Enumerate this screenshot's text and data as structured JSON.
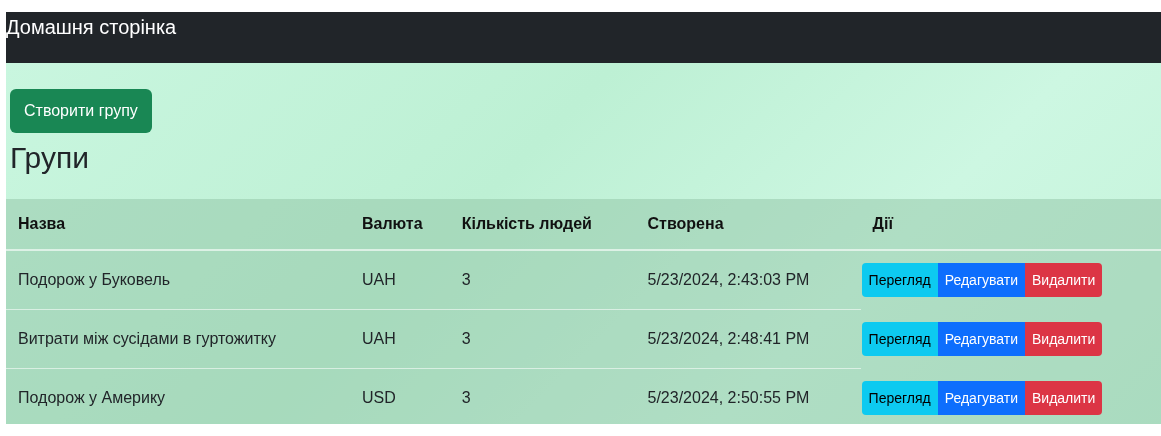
{
  "navbar": {
    "title": "Домашня сторінка"
  },
  "create_button": "Створити групу",
  "heading": "Групи",
  "table": {
    "columns": [
      "Назва",
      "Валюта",
      "Кількість людей",
      "Створена",
      "Дії"
    ],
    "rows": [
      {
        "cells": [
          "Подорож у Буковель",
          "UAH",
          "3",
          "5/23/2024, 2:43:03 PM"
        ],
        "actions": [
          {
            "kind": "view",
            "label": "Перегляд"
          },
          {
            "kind": "edit",
            "label": "Редагувати"
          },
          {
            "kind": "delete",
            "label": "Видалити"
          }
        ]
      },
      {
        "cells": [
          "Витрати між сусідами в гуртожитку",
          "UAH",
          "3",
          "5/23/2024, 2:48:41 PM"
        ],
        "actions": [
          {
            "kind": "view",
            "label": "Перегляд"
          },
          {
            "kind": "edit",
            "label": "Редагувати"
          },
          {
            "kind": "delete",
            "label": "Видалити"
          }
        ]
      },
      {
        "cells": [
          "Подорож у Америку",
          "USD",
          "3",
          "5/23/2024, 2:50:55 PM"
        ],
        "actions": [
          {
            "kind": "view",
            "label": "Перегляд"
          },
          {
            "kind": "edit",
            "label": "Редагувати"
          },
          {
            "kind": "delete",
            "label": "Видалити"
          }
        ]
      }
    ]
  }
}
